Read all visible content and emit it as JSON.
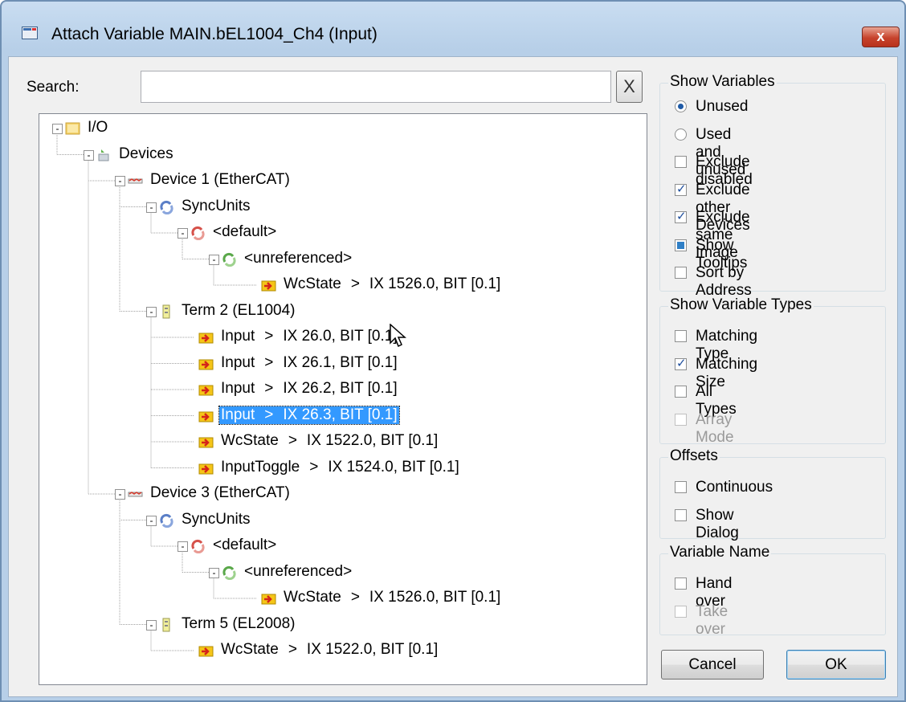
{
  "window": {
    "title": "Attach Variable MAIN.bEL1004_Ch4 (Input)",
    "close_label": "x"
  },
  "search": {
    "label": "Search:",
    "value": "",
    "clear_label": "X"
  },
  "tree": [
    {
      "label": "I/O",
      "level": 0,
      "icon": "io-folder-icon",
      "toggle": "-"
    },
    {
      "label": "Devices",
      "level": 1,
      "icon": "devices-icon",
      "toggle": "-"
    },
    {
      "label": "Device 1 (EtherCAT)",
      "level": 2,
      "icon": "ethercat-device-icon",
      "toggle": "-"
    },
    {
      "label": "SyncUnits",
      "level": 3,
      "icon": "syncunits-icon",
      "toggle": "-"
    },
    {
      "label": "<default>",
      "level": 4,
      "icon": "syncunit-default-icon",
      "toggle": "-"
    },
    {
      "label": "<unreferenced>",
      "level": 5,
      "icon": "syncunit-unreferenced-icon",
      "toggle": "-"
    },
    {
      "label": "WcState",
      "addr": "IX 1526.0, BIT [0.1]",
      "level": 6,
      "icon": "input-variable-icon"
    },
    {
      "label": "Term 2 (EL1004)",
      "level": 3,
      "icon": "terminal-icon",
      "toggle": "-"
    },
    {
      "label": "Input",
      "addr": "IX 26.0, BIT [0.1]",
      "level": 4,
      "icon": "input-variable-icon"
    },
    {
      "label": "Input",
      "addr": "IX 26.1, BIT [0.1]",
      "level": 4,
      "icon": "input-variable-icon"
    },
    {
      "label": "Input",
      "addr": "IX 26.2, BIT [0.1]",
      "level": 4,
      "icon": "input-variable-icon"
    },
    {
      "label": "Input",
      "addr": "IX 26.3, BIT [0.1]",
      "level": 4,
      "icon": "input-variable-icon",
      "selected": true
    },
    {
      "label": "WcState",
      "addr": "IX 1522.0, BIT [0.1]",
      "level": 4,
      "icon": "input-variable-icon"
    },
    {
      "label": "InputToggle",
      "addr": "IX 1524.0, BIT [0.1]",
      "level": 4,
      "icon": "input-variable-icon"
    },
    {
      "label": "Device 3 (EtherCAT)",
      "level": 2,
      "icon": "ethercat-device-icon",
      "toggle": "-"
    },
    {
      "label": "SyncUnits",
      "level": 3,
      "icon": "syncunits-icon",
      "toggle": "-"
    },
    {
      "label": "<default>",
      "level": 4,
      "icon": "syncunit-default-icon",
      "toggle": "-"
    },
    {
      "label": "<unreferenced>",
      "level": 5,
      "icon": "syncunit-unreferenced-icon",
      "toggle": "-"
    },
    {
      "label": "WcState",
      "addr": "IX 1526.0, BIT [0.1]",
      "level": 6,
      "icon": "input-variable-icon"
    },
    {
      "label": "Term 5 (EL2008)",
      "level": 3,
      "icon": "terminal-icon",
      "toggle": "-"
    },
    {
      "label": "WcState",
      "addr": "IX 1522.0, BIT [0.1]",
      "level": 4,
      "icon": "input-variable-icon"
    }
  ],
  "separator": ">",
  "show_variables": {
    "title": "Show Variables",
    "options": [
      {
        "label": "Unused",
        "kind": "radio",
        "checked": true
      },
      {
        "label": "Used and unused",
        "kind": "radio",
        "checked": false
      },
      {
        "label": "Exclude disabled",
        "kind": "checkbox",
        "checked": false
      },
      {
        "label": "Exclude other Devices",
        "kind": "checkbox",
        "checked": true
      },
      {
        "label": "Exclude same Image",
        "kind": "checkbox",
        "checked": true
      },
      {
        "label": "Show Tooltips",
        "kind": "checkbox",
        "checked": "filled"
      },
      {
        "label": "Sort by Address",
        "kind": "checkbox",
        "checked": false
      }
    ]
  },
  "show_variable_types": {
    "title": "Show Variable Types",
    "options": [
      {
        "label": "Matching Type",
        "checked": false
      },
      {
        "label": "Matching Size",
        "checked": true
      },
      {
        "label": "All Types",
        "checked": false
      },
      {
        "label": "Array Mode",
        "checked": false,
        "disabled": true
      }
    ]
  },
  "offsets": {
    "title": "Offsets",
    "options": [
      {
        "label": "Continuous",
        "checked": false
      },
      {
        "label": "Show Dialog",
        "checked": false
      }
    ]
  },
  "variable_name": {
    "title": "Variable Name",
    "options": [
      {
        "label": "Hand over",
        "checked": false
      },
      {
        "label": "Take over",
        "checked": false,
        "disabled": true
      }
    ]
  },
  "buttons": {
    "cancel": "Cancel",
    "ok": "OK"
  },
  "colors": {
    "selection": "#3399ff",
    "titlebar": "#c9ddf1",
    "close": "#c7432c"
  }
}
